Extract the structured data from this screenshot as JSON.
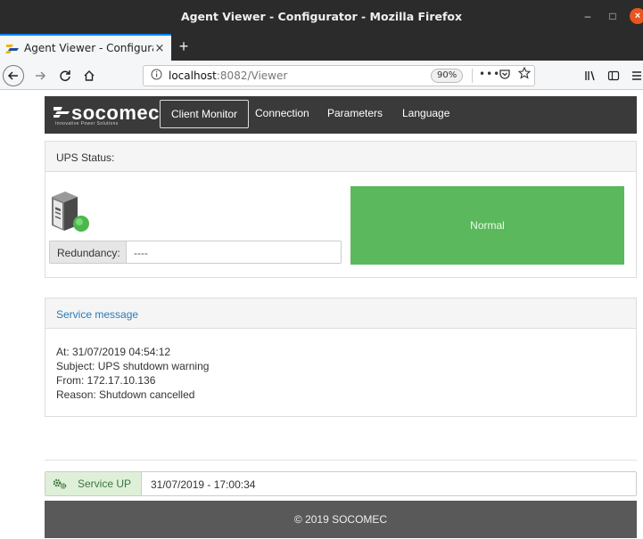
{
  "window": {
    "title": "Agent Viewer - Configurator - Mozilla Firefox",
    "minimize_glyph": "–",
    "maximize_glyph": "□",
    "close_glyph": "×"
  },
  "browser": {
    "tab_title": "Agent Viewer - Configura",
    "tab_close": "×",
    "new_tab": "+",
    "url_host": "localhost",
    "url_rest": ":8082/Viewer",
    "zoom": "90%",
    "more_glyph": "•••"
  },
  "header": {
    "logo_word": "socomec",
    "logo_tagline": "Innovative Power Solutions",
    "nav": {
      "client_monitor": "Client Monitor",
      "connection": "Connection",
      "parameters": "Parameters",
      "language": "Language"
    }
  },
  "ups": {
    "panel_title": "UPS Status:",
    "redundancy_label": "Redundancy:",
    "redundancy_value": "----",
    "status_text": "Normal",
    "status_color": "#5cb85c"
  },
  "service_message": {
    "panel_title": "Service message",
    "lines": [
      "At: 31/07/2019 04:54:12",
      "Subject: UPS shutdown warning",
      "From: 172.17.10.136",
      "Reason: Shutdown cancelled"
    ]
  },
  "service_status": {
    "label": "Service UP",
    "timestamp": "31/07/2019 - 17:00:34",
    "icon": "gears-icon"
  },
  "footer": {
    "text": "© 2019 SOCOMEC"
  },
  "colors": {
    "accent_blue": "#2a7ab8",
    "header_bg": "#3a3a3a",
    "footer_bg": "#595959",
    "success_bg": "#dff0d8"
  }
}
